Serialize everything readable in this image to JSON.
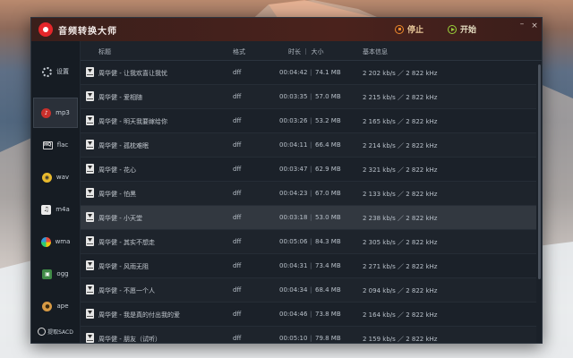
{
  "app": {
    "title": "音频转换大师",
    "stop_label": "停止",
    "start_label": "开始",
    "minimize_symbol": "–",
    "close_symbol": "×"
  },
  "sidebar": {
    "items": [
      {
        "label": "设置",
        "icon": "gear-icon"
      },
      {
        "label": "mp3",
        "icon": "mp3-icon",
        "active": true
      },
      {
        "label": "flac",
        "icon": "flac-icon",
        "badge": "HQ"
      },
      {
        "label": "wav",
        "icon": "wav-icon"
      },
      {
        "label": "m4a",
        "icon": "m4a-icon"
      },
      {
        "label": "wma",
        "icon": "wma-icon"
      },
      {
        "label": "ogg",
        "icon": "ogg-icon"
      },
      {
        "label": "ape",
        "icon": "ape-icon"
      },
      {
        "label": "提取SACD",
        "icon": "sacd-icon"
      }
    ]
  },
  "table": {
    "headers": {
      "title": "标题",
      "format": "格式",
      "duration_size": "时长 ｜ 大小",
      "info": "基本信息"
    },
    "separator": "|",
    "rows": [
      {
        "title": "周华健 - 让我欢喜让我忧",
        "format": "dff",
        "duration": "00:04:42",
        "size": "74.1 MB",
        "info": "2 202 kb/s ／ 2 822 kHz"
      },
      {
        "title": "周华健 - 爱相随",
        "format": "dff",
        "duration": "00:03:35",
        "size": "57.0 MB",
        "info": "2 215 kb/s ／ 2 822 kHz"
      },
      {
        "title": "周华健 - 明天我要嫁给你",
        "format": "dff",
        "duration": "00:03:26",
        "size": "53.2 MB",
        "info": "2 165 kb/s ／ 2 822 kHz"
      },
      {
        "title": "周华健 - 孤枕难眠",
        "format": "dff",
        "duration": "00:04:11",
        "size": "66.4 MB",
        "info": "2 214 kb/s ／ 2 822 kHz"
      },
      {
        "title": "周华健 - 花心",
        "format": "dff",
        "duration": "00:03:47",
        "size": "62.9 MB",
        "info": "2 321 kb/s ／ 2 822 kHz"
      },
      {
        "title": "周华健 - 怕黑",
        "format": "dff",
        "duration": "00:04:23",
        "size": "67.0 MB",
        "info": "2 133 kb/s ／ 2 822 kHz"
      },
      {
        "title": "周华健 - 小天堂",
        "format": "dff",
        "duration": "00:03:18",
        "size": "53.0 MB",
        "info": "2 238 kb/s ／ 2 822 kHz",
        "selected": true
      },
      {
        "title": "周华健 - 其实不想走",
        "format": "dff",
        "duration": "00:05:06",
        "size": "84.3 MB",
        "info": "2 305 kb/s ／ 2 822 kHz"
      },
      {
        "title": "周华健 - 风雨无阻",
        "format": "dff",
        "duration": "00:04:31",
        "size": "73.4 MB",
        "info": "2 271 kb/s ／ 2 822 kHz"
      },
      {
        "title": "周华健 - 不愿一个人",
        "format": "dff",
        "duration": "00:04:34",
        "size": "68.4 MB",
        "info": "2 094 kb/s ／ 2 822 kHz"
      },
      {
        "title": "周华健 - 我是真的付出我的爱",
        "format": "dff",
        "duration": "00:04:46",
        "size": "73.8 MB",
        "info": "2 164 kb/s ／ 2 822 kHz"
      },
      {
        "title": "周华健 - 朋友（试听）",
        "format": "dff",
        "duration": "00:05:10",
        "size": "79.8 MB",
        "info": "2 159 kb/s ／ 2 822 kHz"
      }
    ]
  },
  "colors": {
    "accent_logo": "#e5262a",
    "stop": "#ef8a2c",
    "start": "#9ad13a"
  }
}
